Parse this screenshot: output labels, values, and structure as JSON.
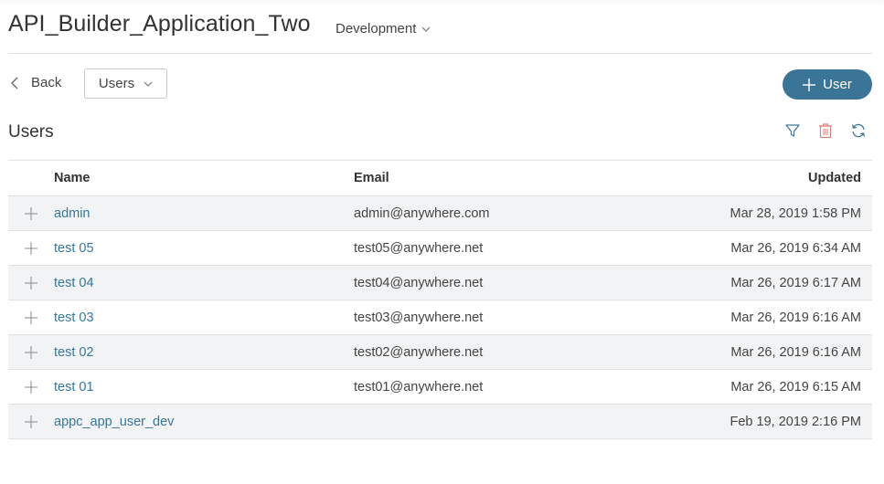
{
  "header": {
    "app_title": "API_Builder_Application_Two",
    "environment": "Development"
  },
  "toolbar": {
    "back_label": "Back",
    "section_select": "Users",
    "add_button_label": "User"
  },
  "section": {
    "title": "Users",
    "icons": [
      "filter-icon",
      "trash-icon",
      "refresh-icon"
    ]
  },
  "table": {
    "columns": {
      "name": "Name",
      "email": "Email",
      "updated": "Updated"
    },
    "rows": [
      {
        "name": "admin",
        "email": "admin@anywhere.com",
        "updated": "Mar 28, 2019 1:58 PM"
      },
      {
        "name": "test 05",
        "email": "test05@anywhere.net",
        "updated": "Mar 26, 2019 6:34 AM"
      },
      {
        "name": "test 04",
        "email": "test04@anywhere.net",
        "updated": "Mar 26, 2019 6:17 AM"
      },
      {
        "name": "test 03",
        "email": "test03@anywhere.net",
        "updated": "Mar 26, 2019 6:16 AM"
      },
      {
        "name": "test 02",
        "email": "test02@anywhere.net",
        "updated": "Mar 26, 2019 6:16 AM"
      },
      {
        "name": "test 01",
        "email": "test01@anywhere.net",
        "updated": "Mar 26, 2019 6:15 AM"
      },
      {
        "name": "appc_app_user_dev",
        "email": "",
        "updated": "Feb 19, 2019 2:16 PM"
      }
    ]
  },
  "colors": {
    "accent": "#3a7598",
    "delete": "#d9827e",
    "row_alt": "#f2f3f4"
  }
}
